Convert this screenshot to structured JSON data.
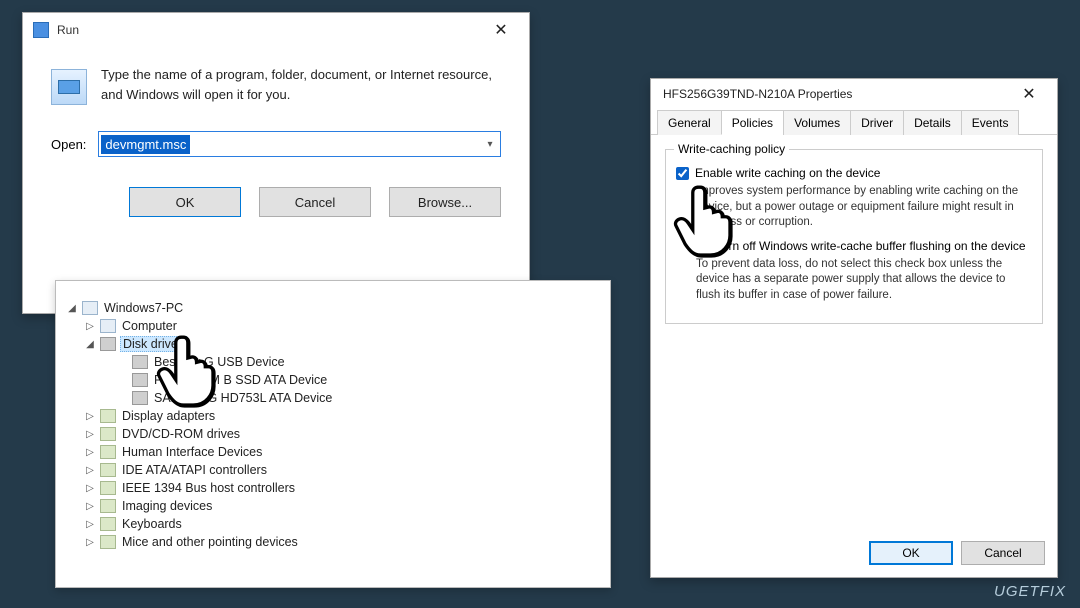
{
  "run": {
    "title": "Run",
    "description": "Type the name of a program, folder, document, or Internet resource, and Windows will open it for you.",
    "open_label": "Open:",
    "open_value": "devmgmt.msc",
    "ok": "OK",
    "cancel": "Cancel",
    "browse": "Browse..."
  },
  "devmgr": {
    "root": "Windows7-PC",
    "nodes": {
      "computer": "Computer",
      "diskdrives": "Disk drives",
      "disks": [
        "BestBuy G                    USB Device",
        "PATRIOT M                B SSD ATA Device",
        "SAMSUNG HD753L ATA Device"
      ],
      "display": "Display adapters",
      "dvd": "DVD/CD-ROM drives",
      "hid": "Human Interface Devices",
      "ide": "IDE ATA/ATAPI controllers",
      "ieee": "IEEE 1394 Bus host controllers",
      "imaging": "Imaging devices",
      "keyboards": "Keyboards",
      "mice": "Mice and other pointing devices"
    }
  },
  "props": {
    "title": "HFS256G39TND-N210A Properties",
    "tabs": [
      "General",
      "Policies",
      "Volumes",
      "Driver",
      "Details",
      "Events"
    ],
    "active_tab": 1,
    "group_legend": "Write-caching policy",
    "chk1_label": "Enable write caching on the device",
    "chk1_checked": true,
    "chk1_desc": "Improves system performance by enabling write caching on the device, but a power outage or equipment failure might result in data loss or corruption.",
    "chk2_label": "Turn off Windows write-cache buffer flushing on the device",
    "chk2_checked": false,
    "chk2_desc": "To prevent data loss, do not select this check box unless the device has a separate power supply that allows the device to flush its buffer in case of power failure.",
    "ok": "OK",
    "cancel": "Cancel"
  },
  "watermark": "UGETFIX"
}
